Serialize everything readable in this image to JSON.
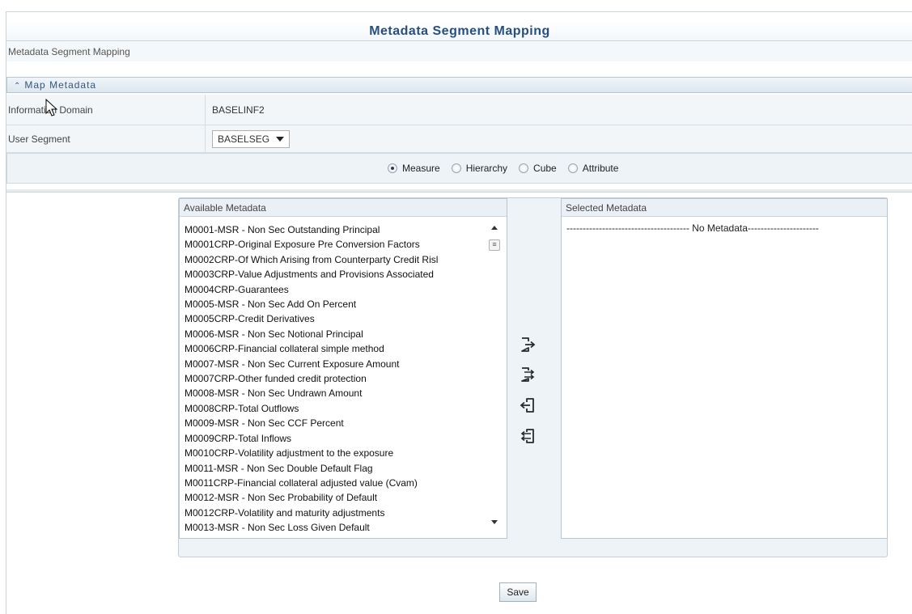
{
  "header": {
    "title": "Metadata Segment Mapping",
    "breadcrumb": "Metadata Segment Mapping"
  },
  "section": {
    "title": "Map Metadata",
    "chevron_icon": "double-chevron-up-icon"
  },
  "form": {
    "info_domain_label": "Information Domain",
    "info_domain_value": "BASELINF2",
    "user_segment_label": "User Segment",
    "user_segment_value": "BASELSEG"
  },
  "metadata_types": {
    "options": [
      "Measure",
      "Hierarchy",
      "Cube",
      "Attribute"
    ],
    "selected": "Measure"
  },
  "available": {
    "header": "Available Metadata",
    "items": [
      "M0001-MSR - Non Sec Outstanding Principal",
      "M0001CRP-Original Exposure Pre Conversion Factors",
      "M0002CRP-Of Which Arising from Counterparty Credit Risl",
      "M0003CRP-Value Adjustments and Provisions Associated",
      "M0004CRP-Guarantees",
      "M0005-MSR - Non Sec Add On Percent",
      "M0005CRP-Credit Derivatives",
      "M0006-MSR - Non Sec Notional Principal",
      "M0006CRP-Financial collateral simple method",
      "M0007-MSR - Non Sec Current Exposure Amount",
      "M0007CRP-Other funded credit protection",
      "M0008-MSR - Non Sec Undrawn Amount",
      "M0008CRP-Total Outflows",
      "M0009-MSR - Non Sec CCF Percent",
      "M0009CRP-Total Inflows",
      "M0010CRP-Volatility adjustment to the exposure",
      "M0011-MSR - Non Sec Double Default Flag",
      "M0011CRP-Financial collateral adjusted value (Cvam)",
      "M0012-MSR - Non Sec Probability of Default",
      "M0012CRP-Volatility and maturity adjustments",
      "M0013-MSR - Non Sec Loss Given Default"
    ]
  },
  "selected": {
    "header": "Selected Metadata",
    "empty_text": "-------------------------------------- No Metadata----------------------"
  },
  "move_buttons": {
    "icons": [
      "move-right-icon",
      "move-all-right-icon",
      "move-left-icon",
      "move-all-left-icon"
    ]
  },
  "actions": {
    "save_label": "Save"
  },
  "colors": {
    "title": "#264f7f",
    "panel_bg": "#eef3f7",
    "border": "#c3ced8",
    "icon": "#2a2a2a"
  }
}
